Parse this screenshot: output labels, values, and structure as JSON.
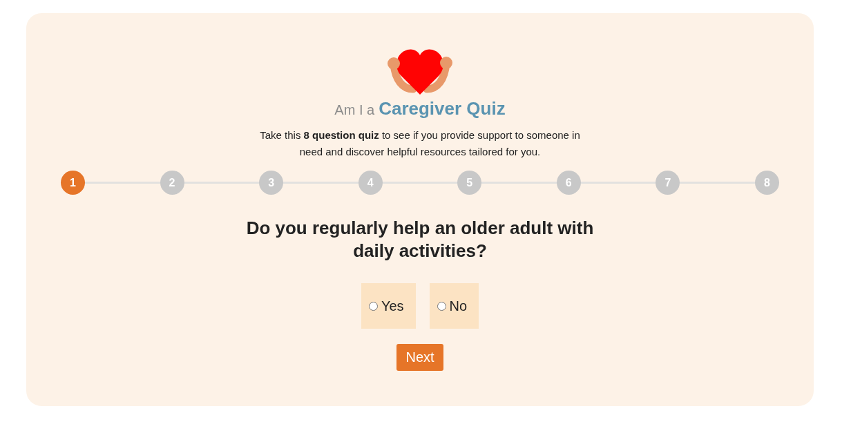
{
  "header": {
    "title_prefix": "Am I a",
    "title": "Caregiver Quiz",
    "description": "Take this **8 question quiz** to see if you provide support to someone in need and discover helpful resources tailored for you."
  },
  "steps": [
    {
      "label": "1",
      "selected": true
    },
    {
      "label": "2",
      "selected": false
    },
    {
      "label": "3",
      "selected": false
    },
    {
      "label": "4",
      "selected": false
    },
    {
      "label": "5",
      "selected": false
    },
    {
      "label": "6",
      "selected": false
    },
    {
      "label": "7",
      "selected": false
    },
    {
      "label": "8",
      "selected": false
    }
  ],
  "question": {
    "text": "Do you regularly help an older adult with daily activities?",
    "options": [
      {
        "label": "Yes",
        "checked": false
      },
      {
        "label": "No",
        "checked": false
      }
    ]
  },
  "buttons": [
    {
      "label": "Next"
    }
  ]
}
